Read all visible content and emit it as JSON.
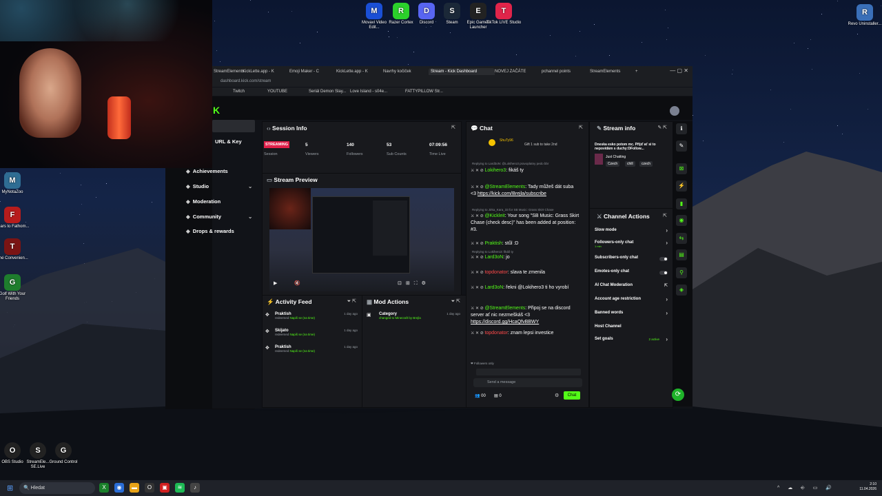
{
  "desktop": {
    "top_icons": [
      {
        "label": "Movavi Video Edit...",
        "icon": "movavi-icon",
        "color": "#1a4fd6"
      },
      {
        "label": "Razer Cortex",
        "icon": "razer-icon",
        "color": "#2bd02b"
      },
      {
        "label": "Discord",
        "icon": "discord-icon",
        "color": "#5865f2"
      },
      {
        "label": "Steam",
        "icon": "steam-icon",
        "color": "#1b2838"
      },
      {
        "label": "Epic Games Launcher",
        "icon": "epic-icon",
        "color": "#222"
      },
      {
        "label": "TikTok LIVE Studio",
        "icon": "tiktok-icon",
        "color": "#e0244a"
      }
    ],
    "right_icon": {
      "label": "Revo Uninstaller...",
      "icon": "revo-icon"
    },
    "left_icons": [
      {
        "label": "MyNotaZoo",
        "icon": "game-icon",
        "color": "#2f6d93"
      },
      {
        "label": "Fears to Fathom...",
        "icon": "f2f-icon",
        "color": "#b71c1c"
      },
      {
        "label": "The Convenien...",
        "icon": "game-icon",
        "color": "#7a1414"
      },
      {
        "label": "Golf With Your Friends",
        "icon": "golf-icon",
        "color": "#1e7d2d"
      }
    ],
    "bottom_icons": [
      {
        "label": "OBS Studio",
        "icon": "obs-icon"
      },
      {
        "label": "StreamEle... SE.Live",
        "icon": "streamelements-icon"
      },
      {
        "label": "Ground Control",
        "icon": "ground-control-icon"
      }
    ]
  },
  "browser": {
    "tabs": [
      "StreamElements",
      "KickLette.app - K",
      "Emoji Maker - C",
      "KickLette.app - K",
      "Navrhy kočiček",
      "Stream - Kick Dashboard",
      "NOVEJ ZAČÁTE",
      "pchannel points",
      "StreamElements"
    ],
    "active_tab": "Stream - Kick Dashboard",
    "url": "dashboard.kick.com/stream",
    "bookmarks": [
      "Twitch",
      "YOUTUBE",
      "Seriál Demon Slay...",
      "Love Island - s04e...",
      "FATTYPILLOW Str..."
    ]
  },
  "sidebar": {
    "url_key": "URL & Key",
    "items": [
      {
        "label": "Achievements",
        "icon": "trophy-icon"
      },
      {
        "label": "Studio",
        "icon": "studio-icon",
        "expandable": true
      },
      {
        "label": "Moderation",
        "icon": "sword-icon"
      },
      {
        "label": "Community",
        "icon": "community-icon",
        "expandable": true
      },
      {
        "label": "Drops & rewards",
        "icon": "gift-icon"
      }
    ]
  },
  "session": {
    "title": "Session Info",
    "status": "STREAMING",
    "status_label": "Session",
    "stats": [
      {
        "value": "5",
        "label": "Viewers"
      },
      {
        "value": "140",
        "label": "Followers"
      },
      {
        "value": "53",
        "label": "Sub Counts"
      },
      {
        "value": "07:09:56",
        "label": "Time Live"
      }
    ]
  },
  "preview": {
    "title": "Stream Preview"
  },
  "activity": {
    "title": "Activity Feed",
    "items": [
      {
        "user": "Praktish",
        "action": "redeemed",
        "reward": "Napiš se (na time)",
        "time": "1 day ago"
      },
      {
        "user": "Skijato",
        "action": "redeemed",
        "reward": "Napiš se (na time)",
        "time": "1 day ago"
      },
      {
        "user": "Praktish",
        "action": "redeemed",
        "reward": "Napiš se (na time)",
        "time": "1 day ago"
      }
    ]
  },
  "mod_actions": {
    "title": "Mod Actions",
    "items": [
      {
        "title": "Category",
        "detail": "changed to Minecraft by Brejla",
        "time": "1 day ago"
      }
    ]
  },
  "chat": {
    "title": "Chat",
    "pinned_user": "ShuTy96",
    "pinned_text": "Gift 1 sub to take 2nd",
    "messages": [
      {
        "reply": "Replying to Lard3oN: @Lokihero3 pravoplatny pedo bbr",
        "user": "Lokihero3",
        "text": ": fikáš ty"
      },
      {
        "user": "@StreamElements",
        "text": ": Tady můžeš dát suba <3 ",
        "link": "https://kick.com/Brejla/subscribe"
      },
      {
        "reply": "Replying to Jirka_Kara_33 for SB Music: Grass Skirt Chase",
        "user": "@Kickleit",
        "text": ": Your song \"SB Music: Grass Skirt Chase (check desc)\" has been added at position: #3."
      },
      {
        "user": "Praktish",
        "text": ": stůl :D"
      },
      {
        "reply": "Replying to Lokihero3: fikáš ty",
        "user": "Lard3oN",
        "text": ": jo"
      },
      {
        "user": "topdonator",
        "text": ": slava te zmenila"
      },
      {
        "user": "Lard3oN",
        "text": ": řekni @Lokihero3 ti ho vyrobí"
      },
      {
        "user": "@StreamElements",
        "text": ": Připoj se na discord server ať nic nezmeškáš <3 ",
        "link": "https://discord.gg/HcaQfvBBWY"
      },
      {
        "user": "topdonator",
        "text": ": znam lepsi investice"
      }
    ],
    "followers_only": "Followers only",
    "input_placeholder": "Send a message",
    "count_users": "00",
    "count_msgs": "0",
    "send_label": "Chat"
  },
  "stream_info": {
    "title": "Stream info",
    "stream_title": "Dneska esko potom mc. Přijď ať si to nepovídám s duchy:DFollow...",
    "category": "Just Chatting",
    "tags": [
      "Czech",
      "chill",
      "czech"
    ]
  },
  "channel_actions": {
    "title": "Channel Actions",
    "items": [
      {
        "label": "Slow mode",
        "control": "chevron"
      },
      {
        "label": "Followers-only chat",
        "sub": "1 min",
        "control": "chevron"
      },
      {
        "label": "Subscribers-only chat",
        "control": "toggle"
      },
      {
        "label": "Emotes-only chat",
        "control": "toggle"
      },
      {
        "label": "AI Chat Moderation",
        "control": "external"
      },
      {
        "label": "Account age restriction",
        "control": "chevron"
      },
      {
        "label": "Banned words",
        "control": "chevron"
      },
      {
        "label": "Host Channel",
        "control": "none"
      },
      {
        "label": "Set goals",
        "badge": "2 active",
        "control": "chevron"
      }
    ]
  },
  "taskbar": {
    "search_placeholder": "Hledat",
    "time": "2:10",
    "date": "11.04.2026"
  },
  "colors": {
    "accent": "#53fc18",
    "live": "#e0204a",
    "panel": "#18191d"
  }
}
